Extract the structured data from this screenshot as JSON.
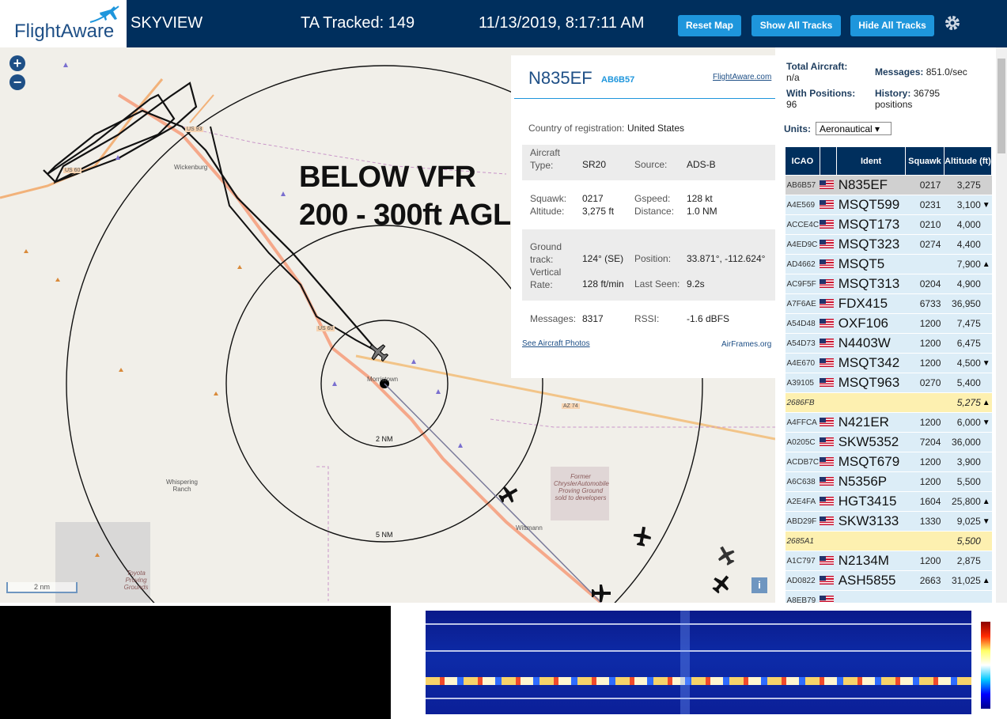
{
  "header": {
    "logo_text": "FlightAware",
    "brand": "SKYVIEW",
    "tracked": "TA Tracked: 149",
    "datetime": "11/13/2019, 8:17:11 AM",
    "buttons": {
      "reset": "Reset Map",
      "show": "Show All Tracks",
      "hide": "Hide All Tracks"
    },
    "colors": {
      "bar": "#002f5d",
      "button": "#1e96dc"
    }
  },
  "map": {
    "zoom_in": "+",
    "zoom_out": "−",
    "annotation_line1": "BELOW VFR",
    "annotation_line2": "200 - 300ft AGL",
    "labels": {
      "town1": "Wickenburg",
      "town2": "Morristown",
      "town3": "Wittmann",
      "ranch": "Whispering Ranch",
      "proving": "Former ChryslerAutomobile Proving Ground sold to developers",
      "toyota": "Toyota Proving Grounds",
      "us60a": "US 60",
      "us60b": "US 60",
      "us93": "US 93",
      "az74": "AZ 74",
      "ring2": "2 NM",
      "ring5": "5 NM"
    },
    "scale": "2 nm",
    "info": "i"
  },
  "detail": {
    "ident": "N835EF",
    "icao": "AB6B57",
    "fa_link": "FlightAware.com",
    "country_label": "Country of registration:",
    "country": "United States",
    "type_label": "Aircraft Type:",
    "type": "SR20",
    "source_label": "Source:",
    "source": "ADS-B",
    "squawk_label": "Squawk:",
    "squawk": "0217",
    "gspeed_label": "Gspeed:",
    "gspeed": "128 kt",
    "altitude_label": "Altitude:",
    "altitude": "3,275 ft",
    "distance_label": "Distance:",
    "distance": "1.0 NM",
    "track_label": "Ground track:",
    "track": "124° (SE)",
    "position_label": "Position:",
    "position": "33.871°, -112.624°",
    "vrate_label": "Vertical Rate:",
    "vrate": "128 ft/min",
    "lastseen_label": "Last Seen:",
    "lastseen": "9.2s",
    "messages_label": "Messages:",
    "messages": "8317",
    "rssi_label": "RSSI:",
    "rssi": "-1.6 dBFS",
    "photos": "See Aircraft Photos",
    "airframes": "AirFrames.org"
  },
  "stats": {
    "total_label": "Total Aircraft:",
    "total": "n/a",
    "messages_label": "Messages:",
    "messages": "851.0/sec",
    "positions_label": "With Positions:",
    "positions": "96",
    "history_label": "History:",
    "history": "36795 positions",
    "units_label": "Units:",
    "units": "Aeronautical ▾"
  },
  "table": {
    "headers": {
      "icao": "ICAO",
      "flag": "",
      "ident": "Ident",
      "squawk": "Squawk",
      "altitude": "Altitude (ft)"
    },
    "rows": [
      {
        "icao": "AB6B57",
        "ident": "N835EF",
        "squawk": "0217",
        "alt": "3,275",
        "trend": "",
        "kind": "sel"
      },
      {
        "icao": "A4E569",
        "ident": "MSQT599",
        "squawk": "0231",
        "alt": "3,100",
        "trend": "▼",
        "kind": ""
      },
      {
        "icao": "ACCE4C",
        "ident": "MSQT173",
        "squawk": "0210",
        "alt": "4,000",
        "trend": "",
        "kind": ""
      },
      {
        "icao": "A4ED9C",
        "ident": "MSQT323",
        "squawk": "0274",
        "alt": "4,400",
        "trend": "",
        "kind": ""
      },
      {
        "icao": "AD4662",
        "ident": "MSQT5",
        "squawk": "",
        "alt": "7,900",
        "trend": "▲",
        "kind": ""
      },
      {
        "icao": "AC9F5F",
        "ident": "MSQT313",
        "squawk": "0204",
        "alt": "4,900",
        "trend": "",
        "kind": ""
      },
      {
        "icao": "A7F6AE",
        "ident": "FDX415",
        "squawk": "6733",
        "alt": "36,950",
        "trend": "",
        "kind": ""
      },
      {
        "icao": "A54D48",
        "ident": "OXF106",
        "squawk": "1200",
        "alt": "7,475",
        "trend": "",
        "kind": ""
      },
      {
        "icao": "A54D73",
        "ident": "N4403W",
        "squawk": "1200",
        "alt": "6,475",
        "trend": "",
        "kind": ""
      },
      {
        "icao": "A4E670",
        "ident": "MSQT342",
        "squawk": "1200",
        "alt": "4,500",
        "trend": "▼",
        "kind": ""
      },
      {
        "icao": "A39105",
        "ident": "MSQT963",
        "squawk": "0270",
        "alt": "5,400",
        "trend": "",
        "kind": ""
      },
      {
        "icao": "2686FB",
        "ident": "",
        "squawk": "",
        "alt": "5,275",
        "trend": "▲",
        "kind": "mlat"
      },
      {
        "icao": "A4FFCA",
        "ident": "N421ER",
        "squawk": "1200",
        "alt": "6,000",
        "trend": "▼",
        "kind": ""
      },
      {
        "icao": "A0205C",
        "ident": "SKW5352",
        "squawk": "7204",
        "alt": "36,000",
        "trend": "",
        "kind": ""
      },
      {
        "icao": "ACDB7C",
        "ident": "MSQT679",
        "squawk": "1200",
        "alt": "3,900",
        "trend": "",
        "kind": ""
      },
      {
        "icao": "A6C638",
        "ident": "N5356P",
        "squawk": "1200",
        "alt": "5,500",
        "trend": "",
        "kind": ""
      },
      {
        "icao": "A2E4FA",
        "ident": "HGT3415",
        "squawk": "1604",
        "alt": "25,800",
        "trend": "▲",
        "kind": ""
      },
      {
        "icao": "ABD29F",
        "ident": "SKW3133",
        "squawk": "1330",
        "alt": "9,025",
        "trend": "▼",
        "kind": ""
      },
      {
        "icao": "2685A1",
        "ident": "",
        "squawk": "",
        "alt": "5,500",
        "trend": "",
        "kind": "mlat"
      },
      {
        "icao": "A1C797",
        "ident": "N2134M",
        "squawk": "1200",
        "alt": "2,875",
        "trend": "",
        "kind": ""
      },
      {
        "icao": "AD0822",
        "ident": "ASH5855",
        "squawk": "2663",
        "alt": "31,025",
        "trend": "▲",
        "kind": ""
      },
      {
        "icao": "A8EB79",
        "ident": "",
        "squawk": "",
        "alt": "",
        "trend": "",
        "kind": ""
      }
    ]
  },
  "spectrum": {
    "colormap_top": "#8b0000",
    "colormap_bottom": "#00008b"
  }
}
